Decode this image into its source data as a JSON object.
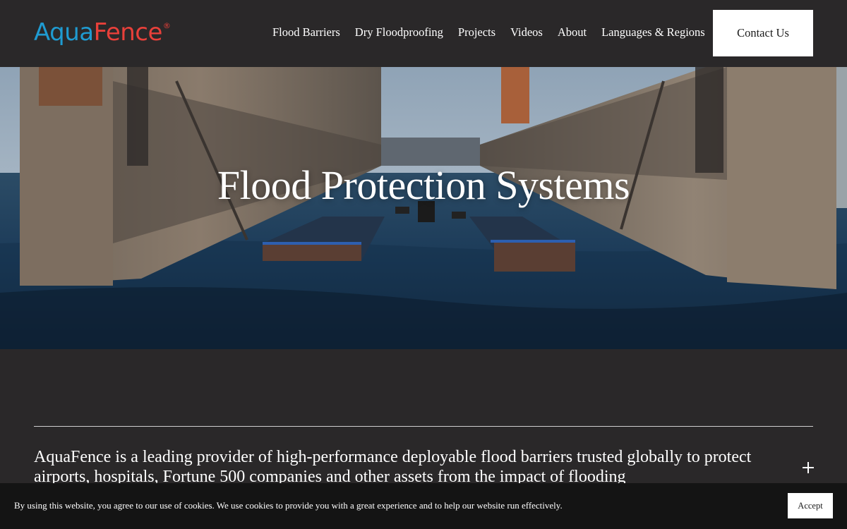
{
  "header": {
    "logo": {
      "part1": "Aqua",
      "part2": "Fence",
      "mark": "®"
    },
    "nav": [
      {
        "label": "Flood Barriers"
      },
      {
        "label": "Dry Floodproofing"
      },
      {
        "label": "Projects"
      },
      {
        "label": "Videos"
      },
      {
        "label": "About"
      },
      {
        "label": "Languages & Regions"
      }
    ],
    "contact_label": "Contact Us"
  },
  "hero": {
    "title": "Flood Protection Systems"
  },
  "intro": {
    "text": "AquaFence is a leading provider of high-performance deployable flood barriers trusted globally to protect airports, hospitals, Fortune 500 companies and other assets from the impact of flooding"
  },
  "cookie": {
    "text": "By using this website, you agree to our use of cookies. We use cookies to provide you with a great experience and to help our website run effectively.",
    "accept_label": "Accept"
  },
  "colors": {
    "background": "#2a2829",
    "logo_aqua": "#1f9bd1",
    "logo_fence": "#e8403a",
    "cookie_bar": "#141414"
  },
  "icons": {
    "expand": "plus-icon"
  }
}
